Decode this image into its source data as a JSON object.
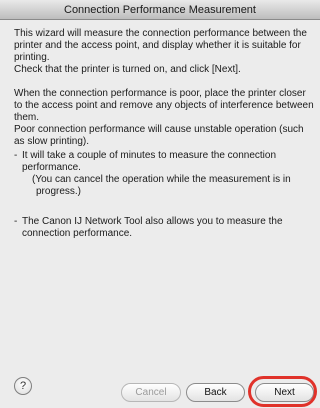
{
  "window": {
    "title": "Connection Performance Measurement"
  },
  "content": {
    "intro": "This wizard will measure the connection performance between the printer and the access point, and display whether it is suitable for printing.",
    "check": "Check that the printer is turned on, and click [Next].",
    "poor_advice": "When the connection performance is poor, place the printer closer to the access point and remove any objects of interference between them.",
    "poor_warning": "Poor connection performance will cause unstable operation (such as slow printing).",
    "bullet1_dash": "-",
    "bullet1_text": "It will take a couple of minutes to measure the connection performance.",
    "bullet1_note": "(You can cancel the operation while the measurement is in progress.)",
    "bullet2_dash": "-",
    "bullet2_text": "The Canon IJ Network Tool also allows you to measure the connection performance."
  },
  "footer": {
    "help_symbol": "?",
    "cancel_label": "Cancel",
    "back_label": "Back",
    "next_label": "Next"
  },
  "colors": {
    "highlight": "#e0322a",
    "window_bg": "#ececec"
  },
  "icons": {
    "help": "help-icon"
  }
}
